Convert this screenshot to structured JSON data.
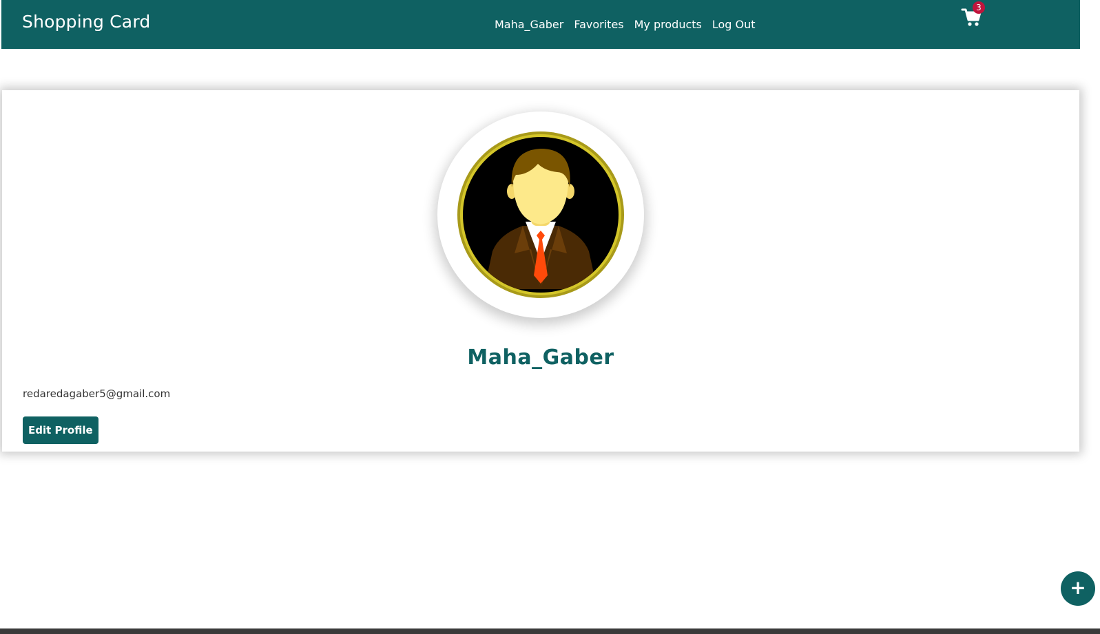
{
  "colors": {
    "brand": "#0f6162",
    "badge": "#c0143c",
    "background": "#ffffff"
  },
  "header": {
    "brand": "Shopping Card",
    "nav": [
      {
        "label": "Maha_Gaber"
      },
      {
        "label": "Favorites"
      },
      {
        "label": "My products"
      },
      {
        "label": "Log Out"
      }
    ],
    "cart": {
      "icon": "shopping-cart-icon",
      "count": "3"
    }
  },
  "profile": {
    "avatar_icon": "businessman-avatar",
    "username": "Maha_Gaber",
    "email": "redaredagaber5@gmail.com",
    "edit_label": "Edit Profile"
  },
  "fab": {
    "icon": "plus-icon",
    "label": "+"
  }
}
